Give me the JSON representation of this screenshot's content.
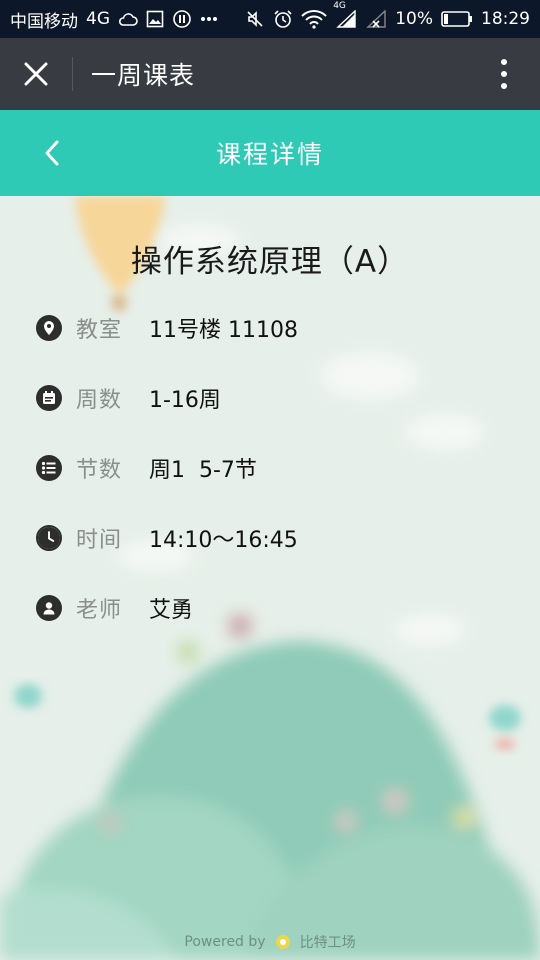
{
  "status_bar": {
    "carrier": "中国移动",
    "network": "4G",
    "network_small": "4G",
    "battery": "10%",
    "time": "18:29",
    "icons": [
      "cloud-icon",
      "image-icon",
      "notification-icon",
      "more-dots-icon",
      "mute-icon",
      "alarm-icon",
      "wifi-icon",
      "signal-icon",
      "battery-icon"
    ]
  },
  "top_bar": {
    "title": "一周课表",
    "close_icon": "close-icon",
    "more_icon": "more-vertical-icon"
  },
  "header": {
    "title": "课程详情",
    "back_icon": "chevron-left-icon"
  },
  "course": {
    "name": "操作系统原理（A）",
    "details": [
      {
        "icon": "location-icon",
        "label": "教室",
        "value": "11号楼 11108"
      },
      {
        "icon": "calendar-icon",
        "label": "周数",
        "value": "1-16周"
      },
      {
        "icon": "list-icon",
        "label": "节数",
        "value": "周1  5-7节"
      },
      {
        "icon": "clock-icon",
        "label": "时间",
        "value": "14:10～16:45"
      },
      {
        "icon": "person-icon",
        "label": "老师",
        "value": "艾勇"
      }
    ]
  },
  "footer": {
    "powered_by": "Powered by",
    "brand": "比特工场"
  },
  "colors": {
    "status_bar": "#0c1729",
    "top_bar": "#383b41",
    "header": "#2ecab6",
    "background": "#e6efe9",
    "hill": "#8fcbb8"
  }
}
